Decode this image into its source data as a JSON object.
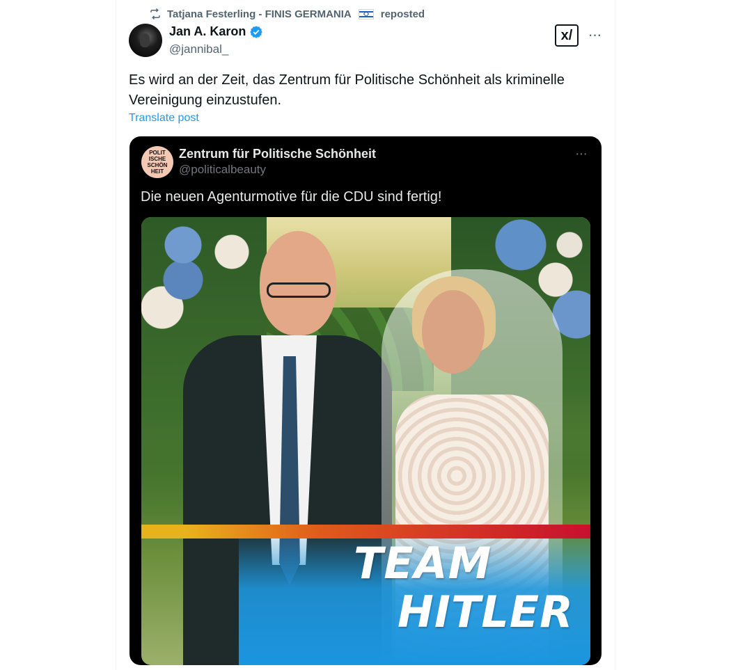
{
  "repost": {
    "reposter": "Tatjana Festerling - FINIS GERMANIA",
    "suffix": "reposted"
  },
  "post": {
    "author_name": "Jan A. Karon",
    "author_handle": "@jannibal_",
    "text": "Es wird an der Zeit, das Zentrum für Politische Schönheit als kriminelle Vereinigung einzustufen.",
    "translate_label": "Translate post",
    "more_label": "···",
    "grok_label": "x/"
  },
  "quote": {
    "avatar_text": [
      "POLIT",
      "ISCHE",
      "SCHÖN",
      "HEIT"
    ],
    "author_name": "Zentrum für Politische Schönheit",
    "author_handle": "@politicalbeauty",
    "text": "Die neuen Agenturmotive für die CDU sind fertig!",
    "more_label": "···",
    "image_text": {
      "line1": "TEAM",
      "line2": "HITLER"
    }
  },
  "colors": {
    "link": "#1d9bf0",
    "verified": "#1d9bf0",
    "muted": "#536471",
    "quote_bg": "#000000",
    "banner_blue": "#1b95e0"
  }
}
